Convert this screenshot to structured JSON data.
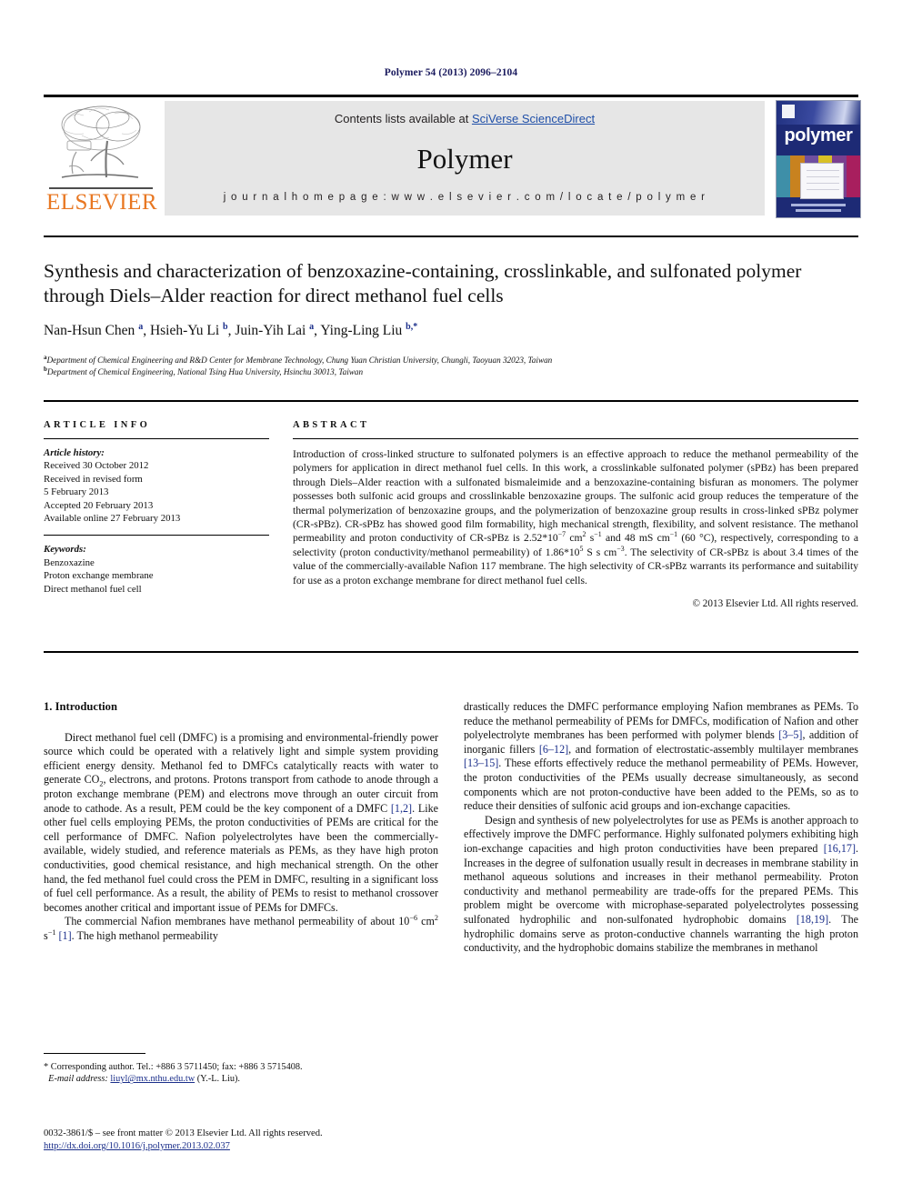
{
  "running_head": "Polymer 54 (2013) 2096–2104",
  "masthead": {
    "publisher_name": "ELSEVIER",
    "contents_prefix": "Contents lists available at ",
    "contents_link": "SciVerse ScienceDirect",
    "journal_title": "Polymer",
    "homepage_label": "j o u r n a l   h o m e p a g e :   w w w . e l s e v i e r . c o m / l o c a t e / p o l y m e r",
    "cover_word": "polymer"
  },
  "article": {
    "title": "Synthesis and characterization of benzoxazine-containing, crosslinkable, and sulfonated polymer through Diels–Alder reaction for direct methanol fuel cells",
    "authors_html": "Nan-Hsun Chen <sup>a</sup>, Hsieh-Yu Li <sup>b</sup>, Juin-Yih Lai <sup>a</sup>, Ying-Ling Liu <sup>b,</sup><sup>*</sup>",
    "affiliation_a": "Department of Chemical Engineering and R&D Center for Membrane Technology, Chung Yuan Christian University, Chungli, Taoyuan 32023, Taiwan",
    "affiliation_b": "Department of Chemical Engineering, National Tsing Hua University, Hsinchu 30013, Taiwan",
    "affil_a_marker": "a",
    "affil_b_marker": "b"
  },
  "info": {
    "heading": "ARTICLE INFO",
    "history_label": "Article history:",
    "history": [
      "Received 30 October 2012",
      "Received in revised form",
      "5 February 2013",
      "Accepted 20 February 2013",
      "Available online 27 February 2013"
    ],
    "keywords_label": "Keywords:",
    "keywords": [
      "Benzoxazine",
      "Proton exchange membrane",
      "Direct methanol fuel cell"
    ]
  },
  "abstract": {
    "heading": "ABSTRACT",
    "text_html": "Introduction of cross-linked structure to sulfonated polymers is an effective approach to reduce the methanol permeability of the polymers for application in direct methanol fuel cells. In this work, a crosslinkable sulfonated polymer (sPBz) has been prepared through Diels&ndash;Alder reaction with a sulfonated bismaleimide and a benzoxazine-containing bisfuran as monomers. The polymer possesses both sulfonic acid groups and crosslinkable benzoxazine groups. The sulfonic acid group reduces the temperature of the thermal polymerization of benzoxazine groups, and the polymerization of benzoxazine group results in cross-linked sPBz polymer (CR-sPBz). CR-sPBz has showed good film formability, high mechanical strength, flexibility, and solvent resistance. The methanol permeability and proton conductivity of CR-sPBz is 2.52*10<sup>&minus;7</sup> cm<sup>2</sup> s<sup>&minus;1</sup> and 48 mS cm<sup>&minus;1</sup> (60 &deg;C), respectively, corresponding to a selectivity (proton conductivity/methanol permeability) of 1.86*10<sup>5</sup> S s cm<sup>&minus;3</sup>. The selectivity of CR-sPBz is about 3.4 times of the value of the commercially-available Nafion 117 membrane. The high selectivity of CR-sPBz warrants its performance and suitability for use as a proton exchange membrane for direct methanol fuel cells.",
    "copyright": "© 2013 Elsevier Ltd. All rights reserved."
  },
  "body": {
    "section_heading": "1. Introduction",
    "left_paragraphs_html": [
      "Direct methanol fuel cell (DMFC) is a promising and environmental-friendly power source which could be operated with a relatively light and simple system providing efficient energy density. Methanol fed to DMFCs catalytically reacts with water to generate CO<sub>2</sub>, electrons, and protons. Protons transport from cathode to anode through a proton exchange membrane (PEM) and electrons move through an outer circuit from anode to cathode. As a result, PEM could be the key component of a DMFC <span class=\"ref\">[1,2]</span>. Like other fuel cells employing PEMs, the proton conductivities of PEMs are critical for the cell performance of DMFC. Nafion polyelectrolytes have been the commercially-available, widely studied, and reference materials as PEMs, as they have high proton conductivities, good chemical resistance, and high mechanical strength. On the other hand, the fed methanol fuel could cross the PEM in DMFC, resulting in a significant loss of fuel cell performance. As a result, the ability of PEMs to resist to methanol crossover becomes another critical and important issue of PEMs for DMFCs.",
      "The commercial Nafion membranes have methanol permeability of about 10<sup>&minus;6</sup> cm<sup>2</sup> s<sup>&minus;1</sup> <span class=\"ref\">[1]</span>. The high methanol permeability"
    ],
    "right_paragraphs_html": [
      "drastically reduces the DMFC performance employing Nafion membranes as PEMs. To reduce the methanol permeability of PEMs for DMFCs, modification of Nafion and other polyelectrolyte membranes has been performed with polymer blends <span class=\"ref\">[3&ndash;5]</span>, addition of inorganic fillers <span class=\"ref\">[6&ndash;12]</span>, and formation of electrostatic-assembly multilayer membranes <span class=\"ref\">[13&ndash;15]</span>. These efforts effectively reduce the methanol permeability of PEMs. However, the proton conductivities of the PEMs usually decrease simultaneously, as second components which are not proton-conductive have been added to the PEMs, so as to reduce their densities of sulfonic acid groups and ion-exchange capacities.",
      "Design and synthesis of new polyelectrolytes for use as PEMs is another approach to effectively improve the DMFC performance. Highly sulfonated polymers exhibiting high ion-exchange capacities and high proton conductivities have been prepared <span class=\"ref\">[16,17]</span>. Increases in the degree of sulfonation usually result in decreases in membrane stability in methanol aqueous solutions and increases in their methanol permeability. Proton conductivity and methanol permeability are trade-offs for the prepared PEMs. This problem might be overcome with microphase-separated polyelectrolytes possessing sulfonated hydrophilic and non-sulfonated hydrophobic domains <span class=\"ref\">[18,19]</span>. The hydrophilic domains serve as proton-conductive channels warranting the high proton conductivity, and the hydrophobic domains stabilize the membranes in methanol"
    ]
  },
  "footnote": {
    "corresponding_html": "* Corresponding author. Tel.: +886 3 5711450; fax: +886 3 5715408.",
    "email_label": "E-mail address:",
    "email": "liuyl@mx.nthu.edu.tw",
    "email_owner": "(Y.-L. Liu)."
  },
  "footer": {
    "issn_line_html": "0032-3861/$ &ndash; see front matter &copy; 2013 Elsevier Ltd. All rights reserved.",
    "doi": "http://dx.doi.org/10.1016/j.polymer.2013.02.037"
  },
  "colors": {
    "elsevier_orange": "#e87722",
    "link_blue": "#1a2e8a",
    "sciencedirect_blue": "#1f4fa8",
    "band_gray": "#e6e6e6",
    "cover_navy": "#1d2a75"
  }
}
